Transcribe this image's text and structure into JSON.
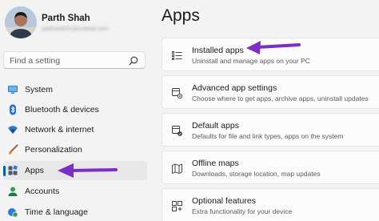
{
  "profile": {
    "name": "Parth Shah",
    "email": "parthshah91@outlook.com"
  },
  "search": {
    "placeholder": "Find a setting"
  },
  "nav": {
    "items": [
      {
        "label": "System",
        "icon": "monitor-icon"
      },
      {
        "label": "Bluetooth & devices",
        "icon": "bluetooth-icon"
      },
      {
        "label": "Network & internet",
        "icon": "wifi-icon"
      },
      {
        "label": "Personalization",
        "icon": "paintbrush-icon"
      },
      {
        "label": "Apps",
        "icon": "apps-icon",
        "selected": true
      },
      {
        "label": "Accounts",
        "icon": "person-icon"
      },
      {
        "label": "Time & language",
        "icon": "globe-clock-icon"
      }
    ]
  },
  "page": {
    "title": "Apps"
  },
  "cards": [
    {
      "title": "Installed apps",
      "subtitle": "Uninstall and manage apps on your PC",
      "icon": "list-icon"
    },
    {
      "title": "Advanced app settings",
      "subtitle": "Choose where to get apps, archive apps, uninstall updates",
      "icon": "app-settings-icon"
    },
    {
      "title": "Default apps",
      "subtitle": "Defaults for file and link types, apps on the system",
      "icon": "default-apps-icon"
    },
    {
      "title": "Offline maps",
      "subtitle": "Downloads, storage location, map updates",
      "icon": "map-icon"
    },
    {
      "title": "Optional features",
      "subtitle": "Extra functionality for your device",
      "icon": "features-icon"
    }
  ],
  "colors": {
    "accent": "#005fb8",
    "annotation_arrow": "#7b2fc4",
    "background": "#f3f3f3",
    "card": "#fbfbfb"
  }
}
